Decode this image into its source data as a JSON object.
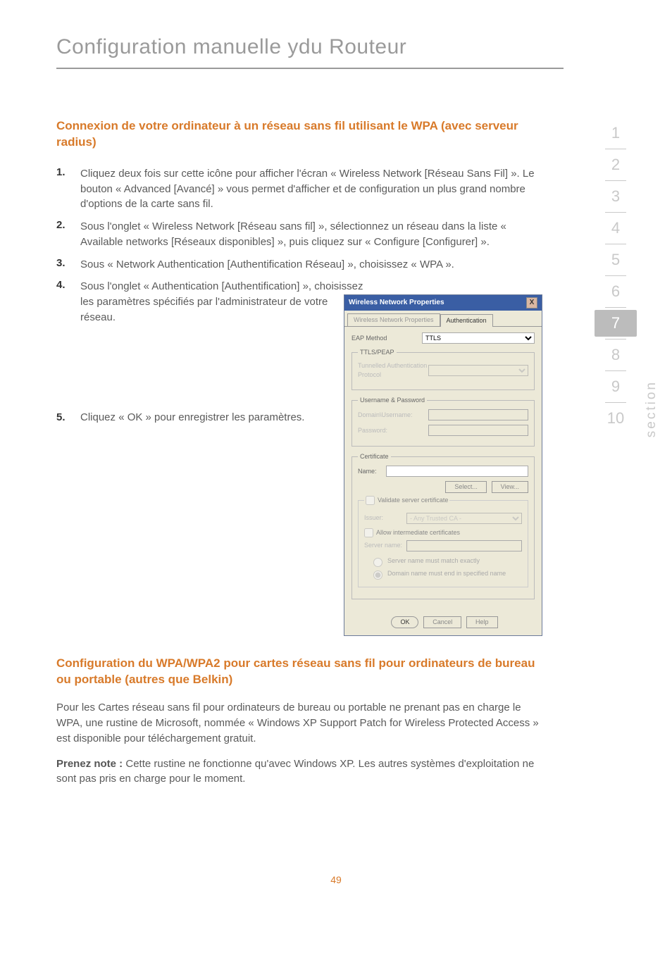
{
  "chapter_title": "Configuration manuelle ydu Routeur",
  "heading_1": "Connexion de votre ordinateur à un réseau sans fil utilisant le WPA (avec serveur radius)",
  "steps": {
    "s1_num": "1.",
    "s1": "Cliquez deux fois sur cette icône pour afficher l'écran « Wireless Network [Réseau Sans Fil] ». Le bouton « Advanced [Avancé] » vous permet d'afficher et de configuration un plus grand nombre d'options de la carte sans fil.",
    "s2_num": "2.",
    "s2": "Sous l'onglet « Wireless Network [Réseau sans fil] », sélectionnez un réseau dans la liste « Available networks [Réseaux disponibles] », puis cliquez sur « Configure [Configurer] ».",
    "s3_num": "3.",
    "s3": "Sous « Network Authentication [Authentification Réseau] », choisissez « WPA ».",
    "s4_num": "4.",
    "s4a": "Sous l'onglet « Authentication [Authentification] », choisissez",
    "s4b": "les paramètres spécifiés par l'administrateur de votre réseau.",
    "s5_num": "5.",
    "s5": "Cliquez « OK » pour enregistrer les paramètres."
  },
  "heading_2": "Configuration du WPA/WPA2 pour cartes réseau sans fil pour ordinateurs de bureau ou portable (autres que Belkin)",
  "para_1": "Pour les Cartes réseau sans fil pour ordinateurs de bureau ou portable ne prenant pas en charge le WPA, une rustine de Microsoft, nommée « Windows XP Support Patch for Wireless Protected Access » est disponible pour téléchargement gratuit.",
  "para_2_strong": "Prenez note :",
  "para_2_rest": " Cette rustine ne fonctionne qu'avec Windows XP. Les autres systèmes d'exploitation ne sont pas pris en charge pour le moment.",
  "page_number": "49",
  "side": {
    "n1": "1",
    "n2": "2",
    "n3": "3",
    "n4": "4",
    "n5": "5",
    "n6": "6",
    "n7": "7",
    "n8": "8",
    "n9": "9",
    "n10": "10",
    "label": "section"
  },
  "dialog": {
    "title": "Wireless Network Properties",
    "close": "X",
    "tab1": "Wireless Network Properties",
    "tab2": "Authentication",
    "eap_method_lbl": "EAP Method",
    "eap_method_val": "TTLS",
    "group_ttls": "TTLS/PEAP",
    "tunnelled_lbl": "Tunnelled Authentication Protocol",
    "group_userpw": "Username & Password",
    "domain_user_lbl": "Domain\\Username:",
    "password_lbl": "Password:",
    "group_cert": "Certificate",
    "name_lbl": "Name:",
    "btn_select": "Select...",
    "btn_view": "View...",
    "validate_chk": "Validate server certificate",
    "issuer_lbl": "Issuer:",
    "issuer_val": "- Any Trusted CA -",
    "allow_chk": "Allow intermediate certificates",
    "server_lbl": "Server name:",
    "radio1": "Server name must match exactly",
    "radio2": "Domain name must end in specified name",
    "btn_ok": "OK",
    "btn_cancel": "Cancel",
    "btn_help": "Help"
  }
}
